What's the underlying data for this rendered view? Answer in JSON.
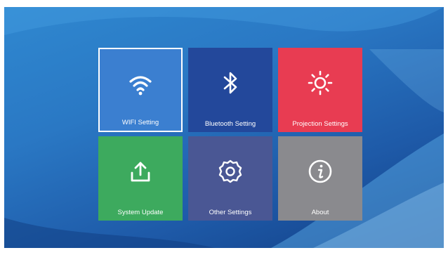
{
  "menu": {
    "tiles": [
      {
        "label": "WIFI Setting",
        "icon": "wifi-icon",
        "color": "#3b7fd0",
        "selected": true
      },
      {
        "label": "Bluetooth Setting",
        "icon": "bluetooth-icon",
        "color": "#23489b"
      },
      {
        "label": "Projection Settings",
        "icon": "brightness-icon",
        "color": "#e83c52"
      },
      {
        "label": "System Update",
        "icon": "upload-icon",
        "color": "#3daa5e"
      },
      {
        "label": "Other Settings",
        "icon": "gear-icon",
        "color": "#4a5794"
      },
      {
        "label": "About",
        "icon": "info-icon",
        "color": "#8a8a8e"
      }
    ]
  },
  "colors": {
    "background": "#2a78c4",
    "selection_border": "#ffffff"
  }
}
